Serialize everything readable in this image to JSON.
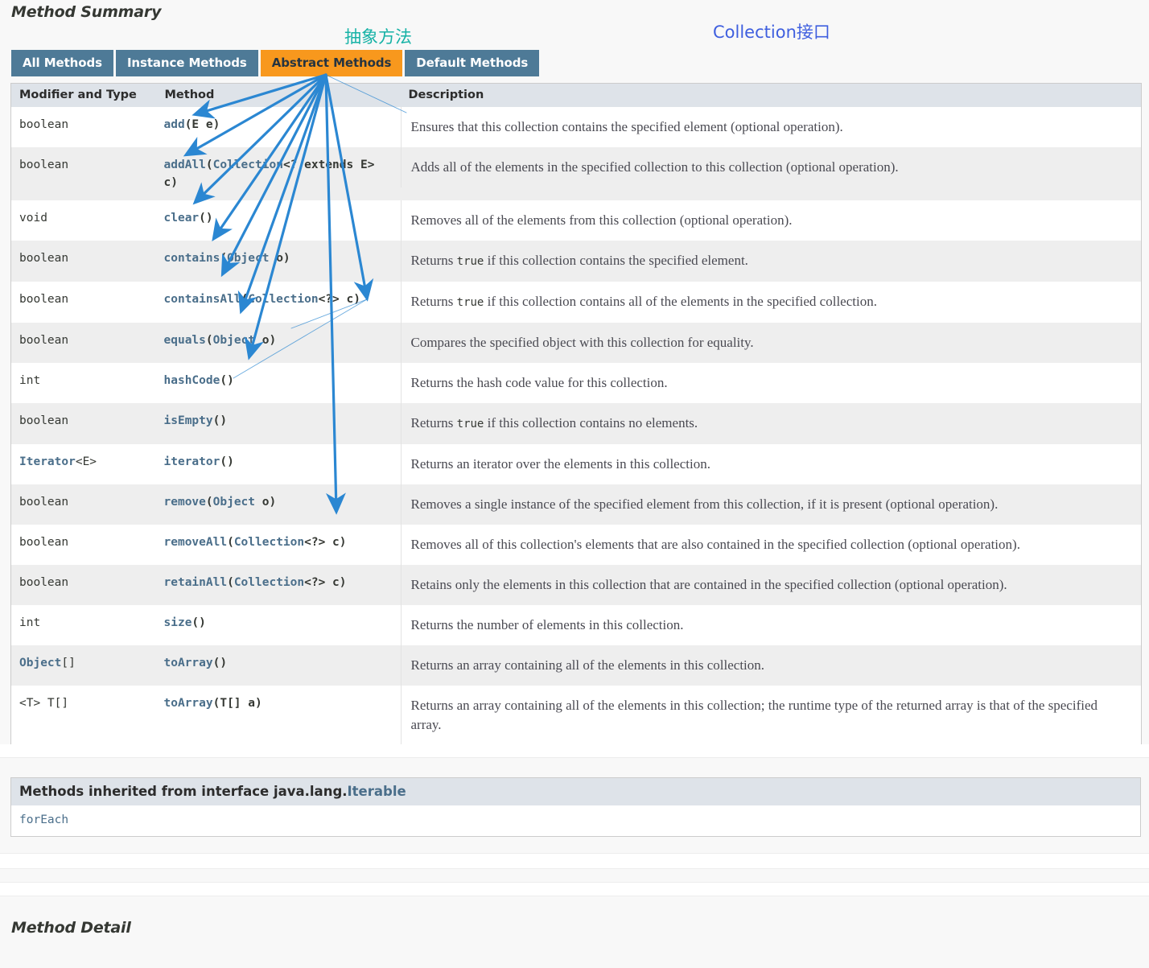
{
  "page": {
    "method_summary_title": "Method Summary",
    "method_detail_title": "Method Detail"
  },
  "annotations": {
    "abstract_label": "抽象方法",
    "abstract_color": "#16b2a6",
    "collection_label": "Collection接口",
    "collection_color": "#3f5fdf",
    "arrow_color": "#2b87d2"
  },
  "tabs": [
    {
      "label": "All Methods",
      "active": false
    },
    {
      "label": "Instance Methods",
      "active": false
    },
    {
      "label": "Abstract Methods",
      "active": true
    },
    {
      "label": "Default Methods",
      "active": false
    }
  ],
  "table": {
    "headers": {
      "modifier": "Modifier and Type",
      "method": "Method",
      "description": "Description"
    },
    "rows": [
      {
        "modifier": "boolean",
        "modifier_link": false,
        "method_name": "add",
        "method_sig": "(E e)",
        "description": "Ensures that this collection contains the specified element (optional operation)."
      },
      {
        "modifier": "boolean",
        "modifier_link": false,
        "method_name": "addAll",
        "method_sig": "(Collection<? extends E> c)",
        "description": "Adds all of the elements in the specified collection to this collection (optional operation)."
      },
      {
        "modifier": "void",
        "modifier_link": false,
        "method_name": "clear",
        "method_sig": "()",
        "description": "Removes all of the elements from this collection (optional operation)."
      },
      {
        "modifier": "boolean",
        "modifier_link": false,
        "method_name": "contains",
        "method_sig": "(Object o)",
        "description": "Returns true if this collection contains the specified element."
      },
      {
        "modifier": "boolean",
        "modifier_link": false,
        "method_name": "containsAll",
        "method_sig": "(Collection<?> c)",
        "description": "Returns true if this collection contains all of the elements in the specified collection."
      },
      {
        "modifier": "boolean",
        "modifier_link": false,
        "method_name": "equals",
        "method_sig": "(Object o)",
        "description": "Compares the specified object with this collection for equality."
      },
      {
        "modifier": "int",
        "modifier_link": false,
        "method_name": "hashCode",
        "method_sig": "()",
        "description": "Returns the hash code value for this collection."
      },
      {
        "modifier": "boolean",
        "modifier_link": false,
        "method_name": "isEmpty",
        "method_sig": "()",
        "description": "Returns true if this collection contains no elements."
      },
      {
        "modifier": "Iterator<E>",
        "modifier_link": true,
        "method_name": "iterator",
        "method_sig": "()",
        "description": "Returns an iterator over the elements in this collection."
      },
      {
        "modifier": "boolean",
        "modifier_link": false,
        "method_name": "remove",
        "method_sig": "(Object o)",
        "description": "Removes a single instance of the specified element from this collection, if it is present (optional operation)."
      },
      {
        "modifier": "boolean",
        "modifier_link": false,
        "method_name": "removeAll",
        "method_sig": "(Collection<?> c)",
        "description": "Removes all of this collection's elements that are also contained in the specified collection (optional operation)."
      },
      {
        "modifier": "boolean",
        "modifier_link": false,
        "method_name": "retainAll",
        "method_sig": "(Collection<?> c)",
        "description": "Retains only the elements in this collection that are contained in the specified collection (optional operation)."
      },
      {
        "modifier": "int",
        "modifier_link": false,
        "method_name": "size",
        "method_sig": "()",
        "description": "Returns the number of elements in this collection."
      },
      {
        "modifier": "Object[]",
        "modifier_link": true,
        "method_name": "toArray",
        "method_sig": "()",
        "description": "Returns an array containing all of the elements in this collection."
      },
      {
        "modifier": "<T> T[]",
        "modifier_link": false,
        "method_name": "toArray",
        "method_sig": "(T[] a)",
        "description": "Returns an array containing all of the elements in this collection; the runtime type of the returned array is that of the specified array."
      }
    ]
  },
  "inherited": {
    "header_prefix": "Methods inherited from interface java.lang.",
    "header_link": "Iterable",
    "methods": "forEach"
  }
}
